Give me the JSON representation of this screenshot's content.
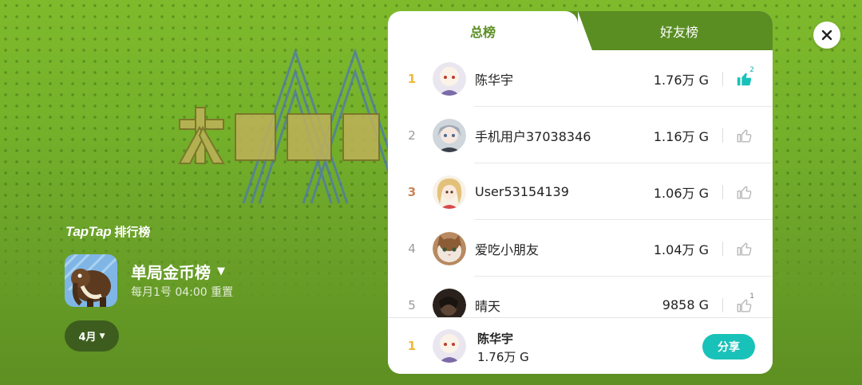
{
  "brand": {
    "tap": "TapTap",
    "rank": "排行榜"
  },
  "board": {
    "title": "单局金币榜",
    "subtitle": "每月1号 04:00 重置",
    "month_label": "4月",
    "icon": "mammoth-game-icon"
  },
  "tabs": {
    "total": "总榜",
    "friends": "好友榜"
  },
  "entries": [
    {
      "rank": "1",
      "name": "陈华宇",
      "score": "1.76万 G",
      "likes": "2",
      "liked": true,
      "avatar": "anime-white-hair-avatar"
    },
    {
      "rank": "2",
      "name": "手机用户37038346",
      "score": "1.16万 G",
      "likes": "",
      "liked": false,
      "avatar": "anime-silver-hair-avatar"
    },
    {
      "rank": "3",
      "name": "User53154139",
      "score": "1.06万 G",
      "likes": "",
      "liked": false,
      "avatar": "anime-blonde-avatar"
    },
    {
      "rank": "4",
      "name": "爱吃小朋友",
      "score": "1.04万 G",
      "likes": "",
      "liked": false,
      "avatar": "cat-avatar"
    },
    {
      "rank": "5",
      "name": "晴天",
      "score": "9858 G",
      "likes": "1",
      "liked": false,
      "avatar": "dark-photo-avatar"
    }
  ],
  "me": {
    "rank": "1",
    "name": "陈华宇",
    "score": "1.76万 G",
    "share_label": "分享"
  },
  "colors": {
    "accent_green": "#5a8e23",
    "teal": "#19c2b8",
    "gold": "#f0b83a",
    "bronze": "#c9865a"
  }
}
